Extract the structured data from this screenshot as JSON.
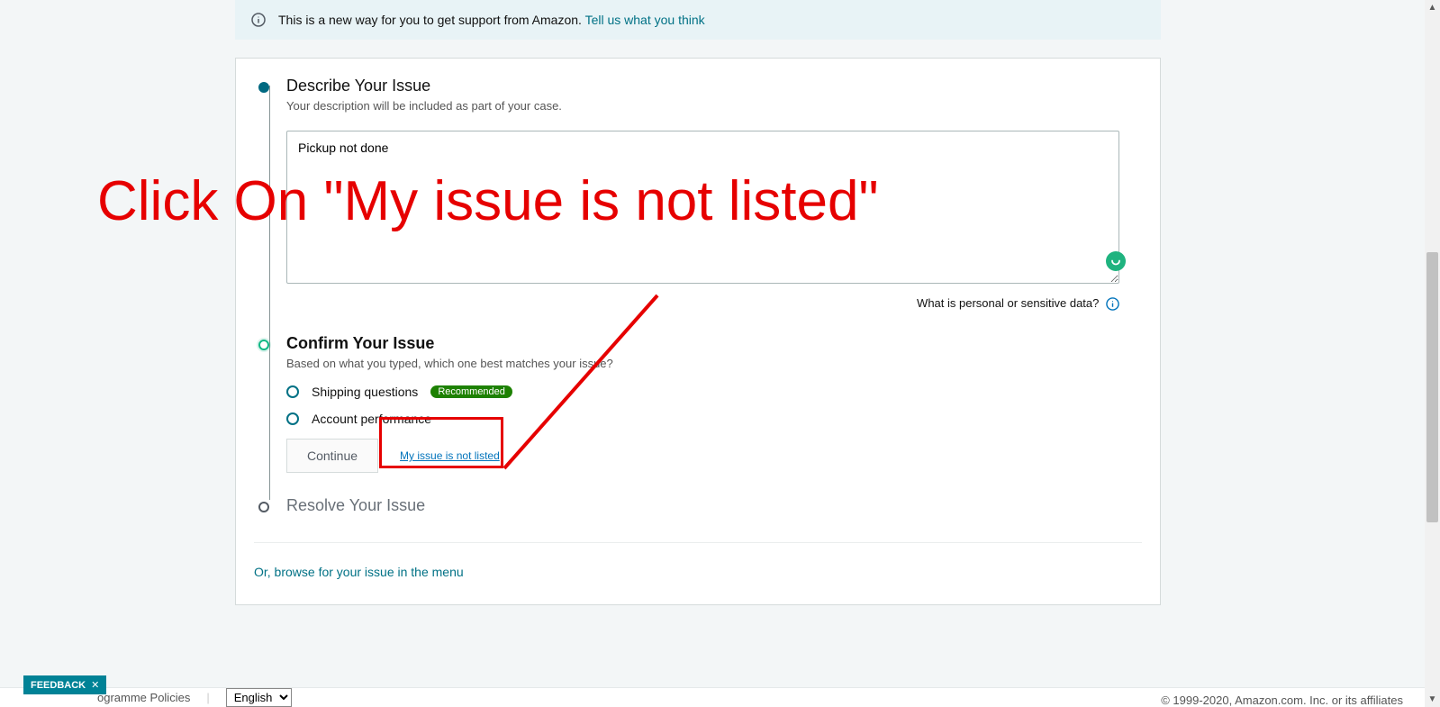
{
  "banner": {
    "text": "This is a new way for you to get support from Amazon. ",
    "link": "Tell us what you think"
  },
  "step1": {
    "title": "Describe Your Issue",
    "sub": "Your description will be included as part of your case.",
    "textarea_value": "Pickup not done",
    "sensitive": "What is personal or sensitive data?"
  },
  "step2": {
    "title": "Confirm Your Issue",
    "sub": "Based on what you typed, which one best matches your issue?",
    "options": [
      {
        "label": "Shipping questions",
        "badge": "Recommended"
      },
      {
        "label": "Account performance",
        "badge": null
      }
    ],
    "continue": "Continue",
    "not_listed": "My issue is not listed"
  },
  "step3": {
    "title": "Resolve Your Issue"
  },
  "browse": "Or, browse for your issue in the menu",
  "annotation": "Click On \"My issue is not listed\"",
  "footer": {
    "feedback": "FEEDBACK",
    "policies": "ogramme Policies",
    "lang": "English",
    "copyright": "© 1999-2020, Amazon.com. Inc. or its affiliates"
  }
}
